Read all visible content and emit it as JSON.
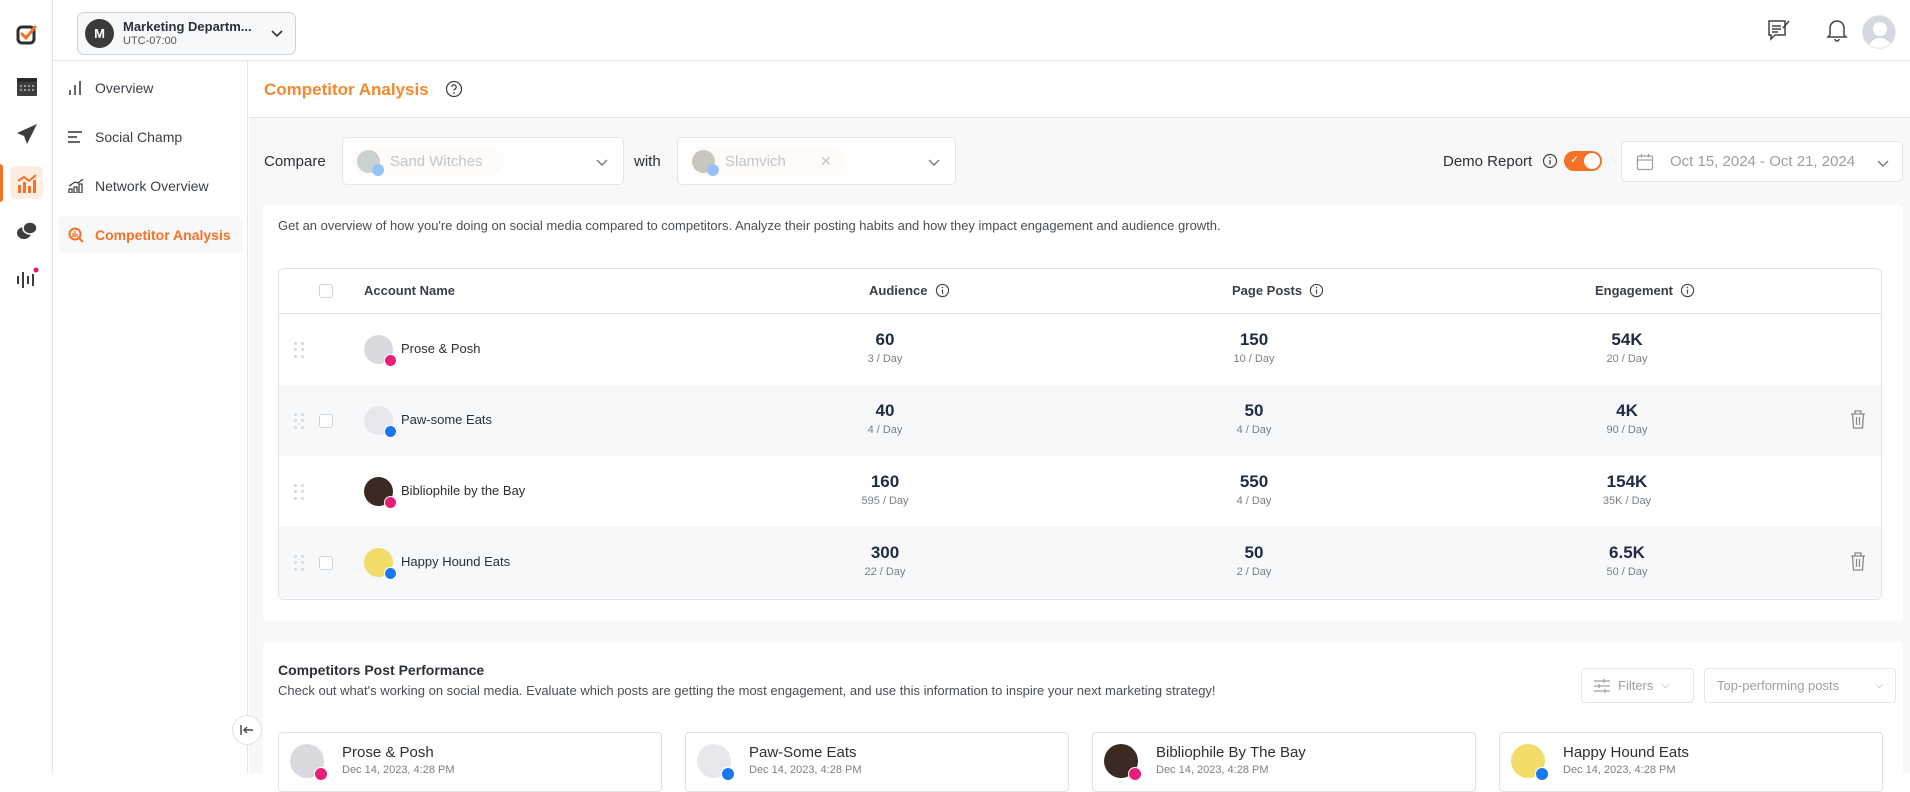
{
  "rail": {
    "items": [
      {
        "icon": "logo-check-icon"
      },
      {
        "icon": "calendar-icon"
      },
      {
        "icon": "send-icon"
      },
      {
        "icon": "analytics-icon",
        "active": true
      },
      {
        "icon": "chat-icon"
      },
      {
        "icon": "listening-icon",
        "badge": true
      }
    ]
  },
  "workspace": {
    "initial": "M",
    "name": "Marketing Departm...",
    "timezone": "UTC-07:00"
  },
  "subnav": {
    "items": [
      {
        "label": "Overview",
        "icon": "bar-chart-icon"
      },
      {
        "label": "Social Champ",
        "icon": "lines-icon"
      },
      {
        "label": "Network Overview",
        "icon": "growth-icon"
      },
      {
        "label": "Competitor Analysis",
        "icon": "competitor-icon",
        "active": true
      }
    ]
  },
  "page": {
    "title": "Competitor Analysis"
  },
  "compare": {
    "label": "Compare",
    "with_label": "with",
    "primary": "Sand Witches",
    "secondary": "Slamvich"
  },
  "demo": {
    "label": "Demo Report",
    "enabled": true
  },
  "date_range": "Oct 15, 2024 - Oct 21, 2024",
  "overview": {
    "description": "Get an overview of how you're doing on social media compared to competitors. Analyze their posting habits and how they impact engagement and audience growth.",
    "columns": [
      "Account Name",
      "Audience",
      "Page Posts",
      "Engagement"
    ],
    "rows": [
      {
        "name": "Prose & Posh",
        "network": "instagram",
        "audience": "60",
        "audience_rate": "3 / Day",
        "posts": "150",
        "posts_rate": "10 / Day",
        "engagement": "54K",
        "engagement_rate": "20 / Day",
        "removable": false
      },
      {
        "name": "Paw-some Eats",
        "network": "facebook",
        "audience": "40",
        "audience_rate": "4 / Day",
        "posts": "50",
        "posts_rate": "4 / Day",
        "engagement": "4K",
        "engagement_rate": "90 / Day",
        "removable": true
      },
      {
        "name": "Bibliophile by the Bay",
        "network": "instagram",
        "audience": "160",
        "audience_rate": "595 / Day",
        "posts": "550",
        "posts_rate": "4 / Day",
        "engagement": "154K",
        "engagement_rate": "35K / Day",
        "removable": false
      },
      {
        "name": "Happy Hound Eats",
        "network": "facebook",
        "audience": "300",
        "audience_rate": "22 / Day",
        "posts": "50",
        "posts_rate": "2 / Day",
        "engagement": "6.5K",
        "engagement_rate": "50 / Day",
        "removable": true
      }
    ]
  },
  "posts": {
    "title": "Competitors Post Performance",
    "description": "Check out what's working on social media. Evaluate which posts are getting the most engagement, and use this information to inspire your next marketing strategy!",
    "filters_label": "Filters",
    "sort_label": "Top-performing posts",
    "cards": [
      {
        "name": "Prose & Posh",
        "date": "Dec 14, 2023, 4:28 PM",
        "network": "instagram"
      },
      {
        "name": "Paw-Some Eats",
        "date": "Dec 14, 2023, 4:28 PM",
        "network": "facebook"
      },
      {
        "name": "Bibliophile By The Bay",
        "date": "Dec 14, 2023, 4:28 PM",
        "network": "instagram"
      },
      {
        "name": "Happy Hound Eats",
        "date": "Dec 14, 2023, 4:28 PM",
        "network": "facebook"
      }
    ]
  },
  "colors": {
    "accent": "#f57224",
    "title": "#f5892e",
    "instagram": "#e91e7a",
    "facebook": "#1877f2"
  }
}
